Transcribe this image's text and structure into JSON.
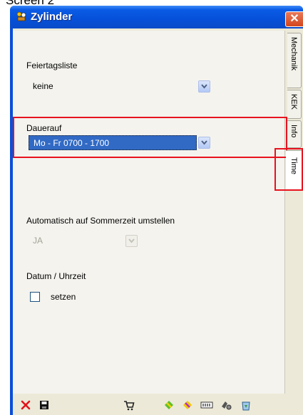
{
  "caption": "Screen 2",
  "window": {
    "title": "Zylinder",
    "close_glyph": "✕"
  },
  "form": {
    "holiday_list": {
      "label": "Feiertagsliste",
      "value": "keine"
    },
    "permanent_open": {
      "label": "Dauerauf",
      "value": "Mo - Fr  0700 - 1700"
    },
    "dst": {
      "label": "Automatisch auf Sommerzeit umstellen",
      "value": "JA"
    },
    "datetime": {
      "label": "Datum / Uhrzeit",
      "checkbox_label": "setzen",
      "checked": false
    }
  },
  "tabs": [
    {
      "label": "Mechanik",
      "active": false
    },
    {
      "label": "KEK",
      "active": false
    },
    {
      "label": "Info",
      "active": false
    },
    {
      "label": "Time",
      "active": true
    }
  ],
  "toolbar": [
    {
      "name": "delete-icon"
    },
    {
      "name": "save-icon"
    },
    {
      "name": "cart-icon"
    },
    {
      "name": "transfer-green-icon"
    },
    {
      "name": "transfer-yellow-icon"
    },
    {
      "name": "binary-icon"
    },
    {
      "name": "transponder-icon"
    },
    {
      "name": "recycle-icon"
    }
  ],
  "colors": {
    "accent": "#316ac5",
    "highlight": "#e8121e",
    "title_bar": "#0650d9"
  }
}
